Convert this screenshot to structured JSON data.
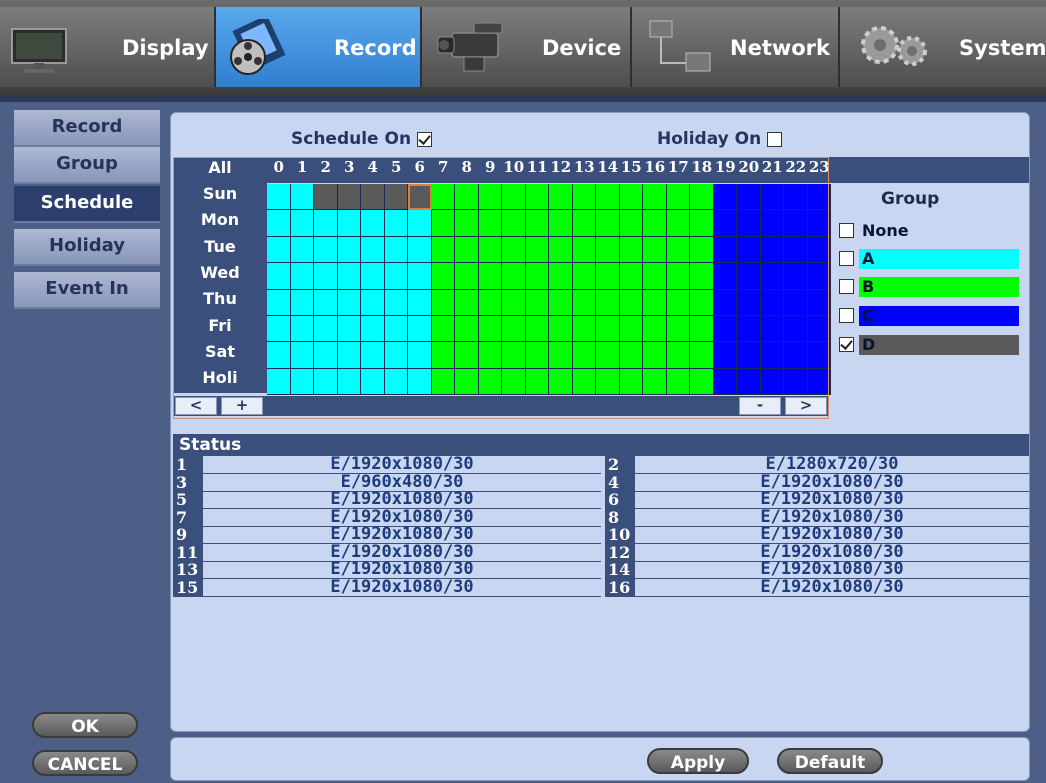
{
  "top_tabs": [
    {
      "label": "Display",
      "icon": "monitor-icon"
    },
    {
      "label": "Record",
      "icon": "film-reel-icon"
    },
    {
      "label": "Device",
      "icon": "camcorder-icon"
    },
    {
      "label": "Network",
      "icon": "network-computers-icon"
    },
    {
      "label": "System",
      "icon": "gears-icon"
    }
  ],
  "sidebar": {
    "items": [
      {
        "label": "Record"
      },
      {
        "label": "Group"
      },
      {
        "label": "Schedule"
      },
      {
        "label": "Holiday"
      },
      {
        "label": "Event In"
      }
    ],
    "ok_label": "OK",
    "cancel_label": "CANCEL"
  },
  "schedule": {
    "schedule_on_label": "Schedule On",
    "schedule_on": true,
    "holiday_on_label": "Holiday On",
    "holiday_on": false,
    "all_label": "All",
    "hours": [
      "0",
      "1",
      "2",
      "3",
      "4",
      "5",
      "6",
      "7",
      "8",
      "9",
      "10",
      "11",
      "12",
      "13",
      "14",
      "15",
      "16",
      "17",
      "18",
      "19",
      "20",
      "21",
      "22",
      "23"
    ],
    "days": [
      "Sun",
      "Mon",
      "Tue",
      "Wed",
      "Thu",
      "Fri",
      "Sat",
      "Holi"
    ],
    "nav": {
      "prev": "<",
      "zoom_in": "+",
      "zoom_out": "-",
      "next": ">"
    },
    "grid": [
      [
        "A",
        "A",
        "D",
        "D",
        "D",
        "D",
        "D",
        "B",
        "B",
        "B",
        "B",
        "B",
        "B",
        "B",
        "B",
        "B",
        "B",
        "B",
        "B",
        "C",
        "C",
        "C",
        "C",
        "C"
      ],
      [
        "A",
        "A",
        "A",
        "A",
        "A",
        "A",
        "A",
        "B",
        "B",
        "B",
        "B",
        "B",
        "B",
        "B",
        "B",
        "B",
        "B",
        "B",
        "B",
        "C",
        "C",
        "C",
        "C",
        "C"
      ],
      [
        "A",
        "A",
        "A",
        "A",
        "A",
        "A",
        "A",
        "B",
        "B",
        "B",
        "B",
        "B",
        "B",
        "B",
        "B",
        "B",
        "B",
        "B",
        "B",
        "C",
        "C",
        "C",
        "C",
        "C"
      ],
      [
        "A",
        "A",
        "A",
        "A",
        "A",
        "A",
        "A",
        "B",
        "B",
        "B",
        "B",
        "B",
        "B",
        "B",
        "B",
        "B",
        "B",
        "B",
        "B",
        "C",
        "C",
        "C",
        "C",
        "C"
      ],
      [
        "A",
        "A",
        "A",
        "A",
        "A",
        "A",
        "A",
        "B",
        "B",
        "B",
        "B",
        "B",
        "B",
        "B",
        "B",
        "B",
        "B",
        "B",
        "B",
        "C",
        "C",
        "C",
        "C",
        "C"
      ],
      [
        "A",
        "A",
        "A",
        "A",
        "A",
        "A",
        "A",
        "B",
        "B",
        "B",
        "B",
        "B",
        "B",
        "B",
        "B",
        "B",
        "B",
        "B",
        "B",
        "C",
        "C",
        "C",
        "C",
        "C"
      ],
      [
        "A",
        "A",
        "A",
        "A",
        "A",
        "A",
        "A",
        "B",
        "B",
        "B",
        "B",
        "B",
        "B",
        "B",
        "B",
        "B",
        "B",
        "B",
        "B",
        "C",
        "C",
        "C",
        "C",
        "C"
      ],
      [
        "A",
        "A",
        "A",
        "A",
        "A",
        "A",
        "A",
        "B",
        "B",
        "B",
        "B",
        "B",
        "B",
        "B",
        "B",
        "B",
        "B",
        "B",
        "B",
        "C",
        "C",
        "C",
        "C",
        "C"
      ]
    ],
    "selected_cell": {
      "day": "Sun",
      "hour": "6"
    }
  },
  "group_panel": {
    "title": "Group",
    "items": [
      {
        "label": "None",
        "color": "",
        "checked": false
      },
      {
        "label": "A",
        "color": "#00ffff",
        "checked": false
      },
      {
        "label": "B",
        "color": "#00ff00",
        "checked": false
      },
      {
        "label": "C",
        "color": "#0000ff",
        "checked": false
      },
      {
        "label": "D",
        "color": "#5a5a5a",
        "checked": true
      }
    ]
  },
  "status": {
    "title": "Status",
    "channels": [
      {
        "num": "1",
        "value": "E/1920x1080/30"
      },
      {
        "num": "2",
        "value": "E/1280x720/30"
      },
      {
        "num": "3",
        "value": "E/960x480/30"
      },
      {
        "num": "4",
        "value": "E/1920x1080/30"
      },
      {
        "num": "5",
        "value": "E/1920x1080/30"
      },
      {
        "num": "6",
        "value": "E/1920x1080/30"
      },
      {
        "num": "7",
        "value": "E/1920x1080/30"
      },
      {
        "num": "8",
        "value": "E/1920x1080/30"
      },
      {
        "num": "9",
        "value": "E/1920x1080/30"
      },
      {
        "num": "10",
        "value": "E/1920x1080/30"
      },
      {
        "num": "11",
        "value": "E/1920x1080/30"
      },
      {
        "num": "12",
        "value": "E/1920x1080/30"
      },
      {
        "num": "13",
        "value": "E/1920x1080/30"
      },
      {
        "num": "14",
        "value": "E/1920x1080/30"
      },
      {
        "num": "15",
        "value": "E/1920x1080/30"
      },
      {
        "num": "16",
        "value": "E/1920x1080/30"
      }
    ]
  },
  "footer": {
    "apply_label": "Apply",
    "default_label": "Default"
  },
  "colors": {
    "A": "#00ffff",
    "B": "#00ff00",
    "C": "#0000ff",
    "D": "#5a5a5a",
    "active_tab": "#3a8ee0",
    "selection": "#e08038"
  }
}
